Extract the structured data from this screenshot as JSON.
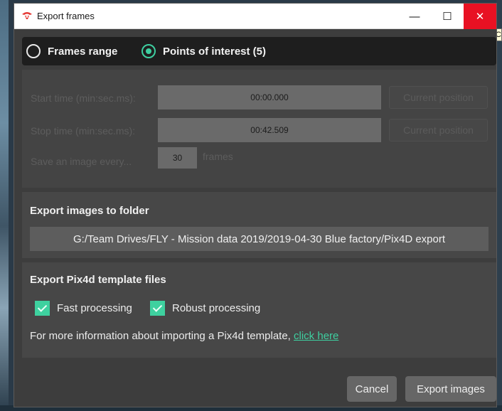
{
  "window": {
    "title": "Export frames",
    "minimize_glyph": "—",
    "maximize_glyph": "☐",
    "close_glyph": "✕",
    "icon": "drone-logo-icon",
    "accent_color": "#3ecfa0",
    "close_color": "#e81123"
  },
  "mode": {
    "options": [
      {
        "label": "Frames range",
        "selected": false
      },
      {
        "label": "Points of interest (5)",
        "selected": true
      }
    ]
  },
  "time_range": {
    "start_label": "Start time (min:sec.ms):",
    "start_value": "00:00.000",
    "stop_label": "Stop time (min:sec.ms):",
    "stop_value": "00:42.509",
    "current_position_label": "Current position",
    "every_label": "Save an image every...",
    "every_value": "30",
    "every_unit": "frames",
    "disabled": true
  },
  "export_folder": {
    "title": "Export images to folder",
    "path": "G:/Team Drives/FLY - Mission data 2019/2019-04-30 Blue factory/Pix4D export"
  },
  "pix4d": {
    "title": "Export Pix4d template files",
    "options": [
      {
        "label": "Fast processing",
        "checked": true
      },
      {
        "label": "Robust processing",
        "checked": true
      }
    ],
    "info_text": "For more information about importing a Pix4d template, ",
    "link_text": "click here"
  },
  "buttons": {
    "cancel": "Cancel",
    "export": "Export images"
  },
  "background": {
    "tooltip_fragment": "C"
  }
}
